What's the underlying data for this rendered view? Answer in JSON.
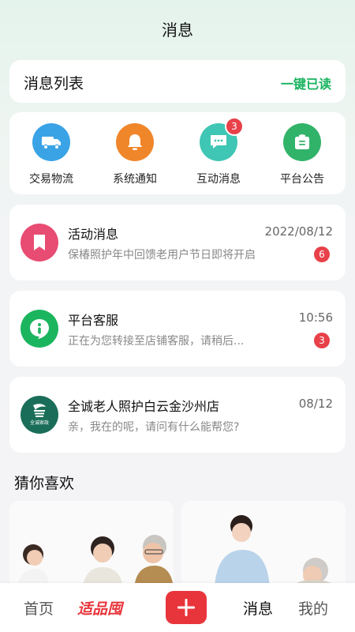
{
  "header": {
    "title": "消息"
  },
  "list_header": {
    "label": "消息列表",
    "action": "一键已读"
  },
  "categories": [
    {
      "label": "交易物流",
      "icon": "truck-icon",
      "color": "#3aa3e6"
    },
    {
      "label": "系统通知",
      "icon": "bell-icon",
      "color": "#f0862a"
    },
    {
      "label": "互动消息",
      "icon": "chat-icon",
      "color": "#3fc6b4",
      "badge": "3"
    },
    {
      "label": "平台公告",
      "icon": "notice-icon",
      "color": "#32b36a"
    }
  ],
  "messages": [
    {
      "title": "活动消息",
      "time": "2022/08/12",
      "preview": "保椿照护年中回馈老用户节日即将开启",
      "count": "6",
      "icon": "bookmark-icon",
      "color": "#e84c72"
    },
    {
      "title": "平台客服",
      "time": "10:56",
      "preview": "正在为您转接至店铺客服，请稍后...",
      "count": "3",
      "icon": "service-icon",
      "color": "#1cb55f"
    },
    {
      "title": "全诚老人照护白云金沙州店",
      "time": "08/12",
      "preview": "亲，我在的呢，请问有什么能帮您?",
      "icon": "store-logo-icon",
      "color": "#1a6e59",
      "logo_text": "全诚家政"
    }
  ],
  "recommend": {
    "title": "猜你喜欢"
  },
  "tabbar": {
    "home": "首页",
    "brand": "适品囤",
    "messages": "消息",
    "mine": "我的"
  }
}
